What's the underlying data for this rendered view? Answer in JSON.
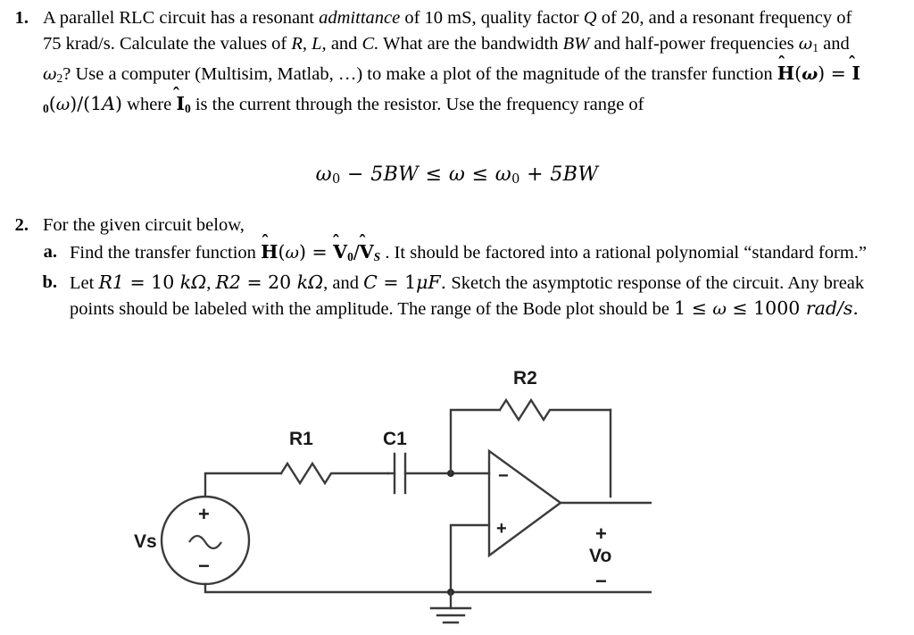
{
  "document": {
    "questions": [
      {
        "number": "1.",
        "line1_a": "A parallel RLC circuit has a resonant ",
        "line1_italic": "admittance",
        "line1_b": " of 10 mS, quality factor ",
        "line1_Q": "Q",
        "line1_c": " of 20, and a",
        "line2_a": "resonant frequency of 75 krad/s.  Calculate the values of ",
        "line2_R": "R,",
        "line2_L": "L,",
        "line2_b": " and ",
        "line2_C": "C.",
        "line2_c": "  What are the",
        "line3_a": "bandwidth ",
        "line3_BW": "BW",
        "line3_b": " and half-power frequencies ",
        "line3_w1": "ω",
        "line3_w1sub": "1",
        "line3_c": " and ",
        "line3_w2": "ω",
        "line3_w2sub": "2",
        "line3_d": "?  Use a computer (Multisim,",
        "line4_a": "Matlab, …) to make a plot of the magnitude of the transfer function ",
        "line4_H": "H",
        "line4_b": "(",
        "line4_w": "ω",
        "line4_c": ") = ",
        "line4_I": "I",
        "line4_Isub": "0",
        "line4_d": "(",
        "line4_w2": "ω",
        "line4_e": ")/(1",
        "line4_A": "A",
        "line4_f": ")",
        "line5_a": "where ",
        "line5_I": "I",
        "line5_Isub": "0",
        "line5_b": " is the current through the resistor.  Use the frequency range of"
      },
      {
        "number": "2.",
        "stem": "For the given circuit below,",
        "subitems": [
          {
            "letter": "a.",
            "text_a": "Find the transfer function ",
            "H": "H",
            "text_b": "(",
            "omega": "ω",
            "text_c": ") = ",
            "V0": "V",
            "V0sub": "0",
            "slash": "/",
            "VS": "V",
            "VSsub": "S",
            "text_d": " .  It should be factored into a rational",
            "line2": "polynomial “standard form.”"
          },
          {
            "letter": "b.",
            "text_a": "Let ",
            "R1": "R1",
            "eq1": " = ",
            "val1": "10 ",
            "unit1": "kΩ",
            "comma1": ", ",
            "R2": "R2",
            "eq2": " = ",
            "val2": "20 ",
            "unit2": "kΩ",
            "comma2": ", and ",
            "C": "C",
            "eq3": " = ",
            "val3": "1",
            "unit3": "μF",
            "period": ".",
            "text_b": "  Sketch the asymptotic response of the",
            "line2": "circuit.  Any break points should be labeled with the amplitude.  The range of the",
            "line3_a": "Bode plot should be ",
            "line3_one": "1",
            "line3_le1": " ≤ ",
            "line3_w": "ω",
            "line3_le2": " ≤ ",
            "line3_thousand": "1000 ",
            "line3_unit": "rad/s",
            "line3_period": "."
          }
        ]
      }
    ],
    "display_equation": {
      "omega1": "ω",
      "sub1": "0",
      "minus": " − ",
      "five_bw_1": "5BW",
      "le1": " ≤ ",
      "omega_mid": "ω",
      "le2": " ≤ ",
      "omega2": "ω",
      "sub2": "0",
      "plus": " + ",
      "five_bw_2": "5BW"
    }
  },
  "circuit": {
    "title": "inverting-op-amp-high-pass-circuit",
    "labels": {
      "source": "Vs",
      "r1": "R1",
      "c1": "C1",
      "r2": "R2",
      "vo": "Vo",
      "source_plus": "+",
      "source_minus": "−",
      "opamp_minus": "−",
      "opamp_plus": "+",
      "vo_plus": "+",
      "vo_minus": "−"
    },
    "colors": {
      "wire": "#3b3b3b",
      "text": "#1a1a1a",
      "background": "#ffffff"
    }
  }
}
